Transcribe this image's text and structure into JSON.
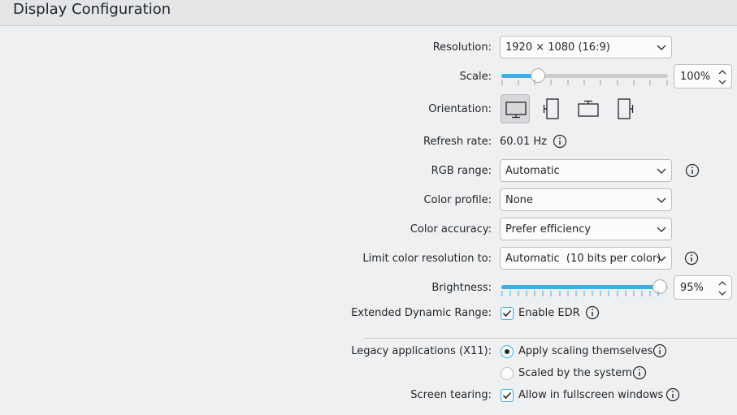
{
  "header": {
    "title": "Display Configuration"
  },
  "resolution": {
    "label": "Resolution:",
    "value": "1920 × 1080 (16:9)"
  },
  "scale": {
    "label": "Scale:",
    "value": "100%",
    "level": 0.22
  },
  "orientation": {
    "label": "Orientation:",
    "options": [
      "landscape",
      "portrait-left",
      "landscape-flipped",
      "portrait-right"
    ],
    "selected": "landscape"
  },
  "refresh_rate": {
    "label": "Refresh rate:",
    "value": "60.01 Hz"
  },
  "rgb_range": {
    "label": "RGB range:",
    "value": "Automatic"
  },
  "color_profile": {
    "label": "Color profile:",
    "value": "None"
  },
  "color_accuracy": {
    "label": "Color accuracy:",
    "value": "Prefer efficiency"
  },
  "limit_color_resolution": {
    "label": "Limit color resolution to:",
    "value": "Automatic  (10 bits per color)"
  },
  "brightness": {
    "label": "Brightness:",
    "value": "95%",
    "level": 0.95
  },
  "edr": {
    "label": "Extended Dynamic Range:",
    "option": "Enable EDR",
    "checked": true
  },
  "legacy": {
    "label": "Legacy applications (X11):",
    "options": [
      "Apply scaling themselves",
      "Scaled by the system"
    ],
    "selected": "Apply scaling themselves"
  },
  "screen_tearing": {
    "label": "Screen tearing:",
    "option": "Allow in fullscreen windows",
    "checked": true
  },
  "colors": {
    "accent": "#3daee9",
    "text": "#232629",
    "background": "#eff0f1"
  }
}
